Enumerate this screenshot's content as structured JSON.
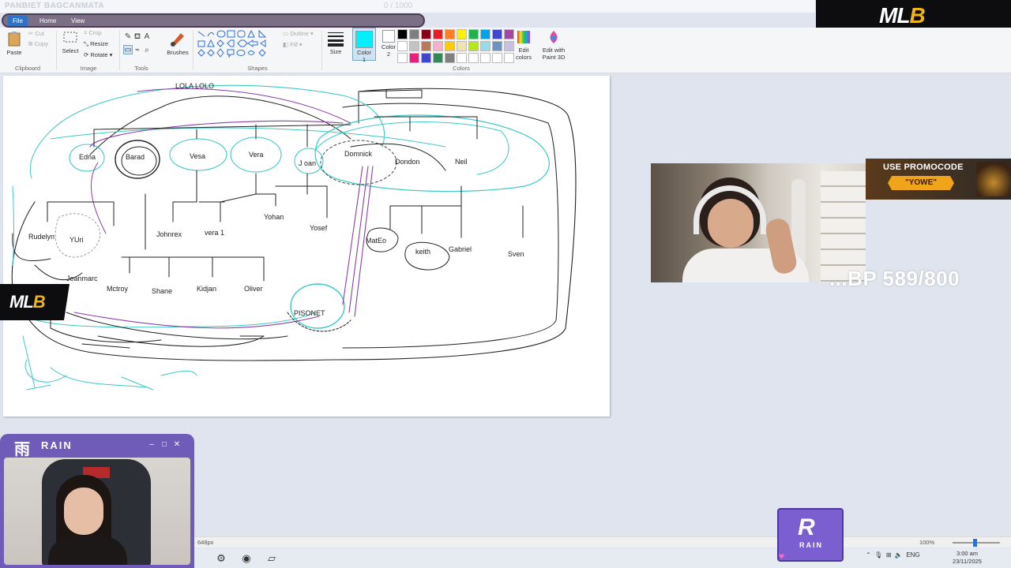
{
  "overlay": {
    "title": "PANBIET BAGCANMATA",
    "goal": "0   / 1000",
    "mlb_logo": "MLB",
    "mlb_logo_accent": "B",
    "promo_line": "USE PROMOCODE",
    "promo_code": "\"YOWE\"",
    "bp_text": "...BP 589/800",
    "rain_name": "RAIN",
    "rain_kanji": "雨",
    "rain_badge_text": "RAIN"
  },
  "menu": {
    "file": "File",
    "home": "Home",
    "view": "View"
  },
  "ribbon": {
    "clipboard": {
      "label": "Clipboard",
      "paste": "Paste",
      "cut": "Cut",
      "copy": "Copy"
    },
    "image": {
      "label": "Image",
      "select": "Select",
      "crop": "Crop",
      "resize": "Resize",
      "rotate": "Rotate"
    },
    "tools": {
      "label": "Tools"
    },
    "brushes": {
      "label": "Brushes"
    },
    "shapes": {
      "label": "Shapes",
      "outline": "Outline",
      "fill": "Fill"
    },
    "size": {
      "label": "Size"
    },
    "colors": {
      "label": "Colors",
      "color1": "Color\n1",
      "color1_a": "Color",
      "color1_b": "1",
      "color2_a": "Color",
      "color2_b": "2",
      "edit_colors_a": "Edit",
      "edit_colors_b": "colors",
      "paint3d_a": "Edit with",
      "paint3d_b": "Paint 3D",
      "color1_value": "#00f0ff",
      "color2_value": "#ffffff",
      "palette": [
        "#000000",
        "#7f7f7f",
        "#880015",
        "#ed1c24",
        "#ff7f27",
        "#fff200",
        "#22b14c",
        "#00a2e8",
        "#3f48cc",
        "#a349a4",
        "#ffffff",
        "#c3c3c3",
        "#b97a57",
        "#ffaec9",
        "#ffc90e",
        "#efe4b0",
        "#b5e61d",
        "#99d9ea",
        "#7092be",
        "#c8bfe7",
        "#ffffff",
        "#ed1c7f",
        "#3f48cc",
        "#2e8b57",
        "#808080",
        "#ffffff",
        "#ffffff",
        "#ffffff",
        "#ffffff",
        "#ffffff"
      ]
    }
  },
  "canvas": {
    "names": {
      "lola": "LOLA LOLO",
      "edna": "Edna",
      "barad": "Barad",
      "vesa": "Vesa",
      "vera": "Vera",
      "joan": "J oan",
      "domnick": "Domnick",
      "dondon": "Dondon",
      "neil": "Neil",
      "rudelyn": "Rudelyn",
      "yuri": "YUri",
      "johnrex": "Johnrex",
      "vera1": "vera 1",
      "yohan": "Yohan",
      "yosef": "Yosef",
      "mateo": "MatEo",
      "keith": "keith",
      "gabriel": "Gabriel",
      "sven": "Sven",
      "jeanmarc": "Jeanmarc",
      "mctroy": "Mctroy",
      "shane": "Shane",
      "kidjan": "Kidjan",
      "oliver": "Oliver",
      "pisonet": "PISONET"
    }
  },
  "status": {
    "size": "648px",
    "zoom": "100%"
  },
  "taskbar": {
    "lang": "ENG",
    "time": "3:00 am",
    "date": "23/11/2025"
  }
}
